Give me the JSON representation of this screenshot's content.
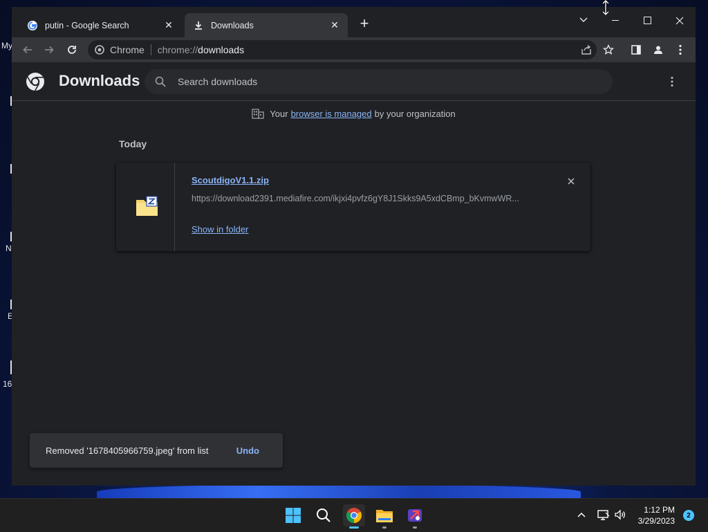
{
  "desktop": {
    "fragments": [
      "My",
      "N",
      "E",
      "16"
    ]
  },
  "browser": {
    "tabs": [
      {
        "title": "putin - Google Search",
        "icon": "google-icon",
        "active": false
      },
      {
        "title": "Downloads",
        "icon": "download-icon",
        "active": true
      }
    ],
    "omnibox": {
      "chip": "Chrome",
      "url_scheme": "chrome://",
      "url_path": "downloads"
    }
  },
  "downloads_page": {
    "title": "Downloads",
    "search_placeholder": "Search downloads",
    "managed": {
      "prefix": "Your",
      "link": "browser is managed",
      "suffix": "by your organization"
    },
    "section_label": "Today",
    "items": [
      {
        "file_name": "ScoutdigoV1.1.zip",
        "url": "https://download2391.mediafire.com/ikjxi4pvfz6gY8J1Skks9A5xdCBmp_bKvmwWR...",
        "action": "Show in folder",
        "icon": "zip-file-icon"
      }
    ],
    "toast": {
      "message": "Removed '1678405966759.jpeg' from list",
      "action": "Undo"
    }
  },
  "taskbar": {
    "time": "1:12 PM",
    "date": "3/29/2023",
    "notification_count": "2",
    "apps": [
      "start-icon",
      "search-icon",
      "chrome-icon",
      "file-explorer-icon",
      "app-icon"
    ]
  },
  "colors": {
    "accent_link": "#8ab4f8",
    "page_bg": "#202124",
    "toolbar_bg": "#35363a",
    "taskbar_accent": "#4cc2ff"
  }
}
